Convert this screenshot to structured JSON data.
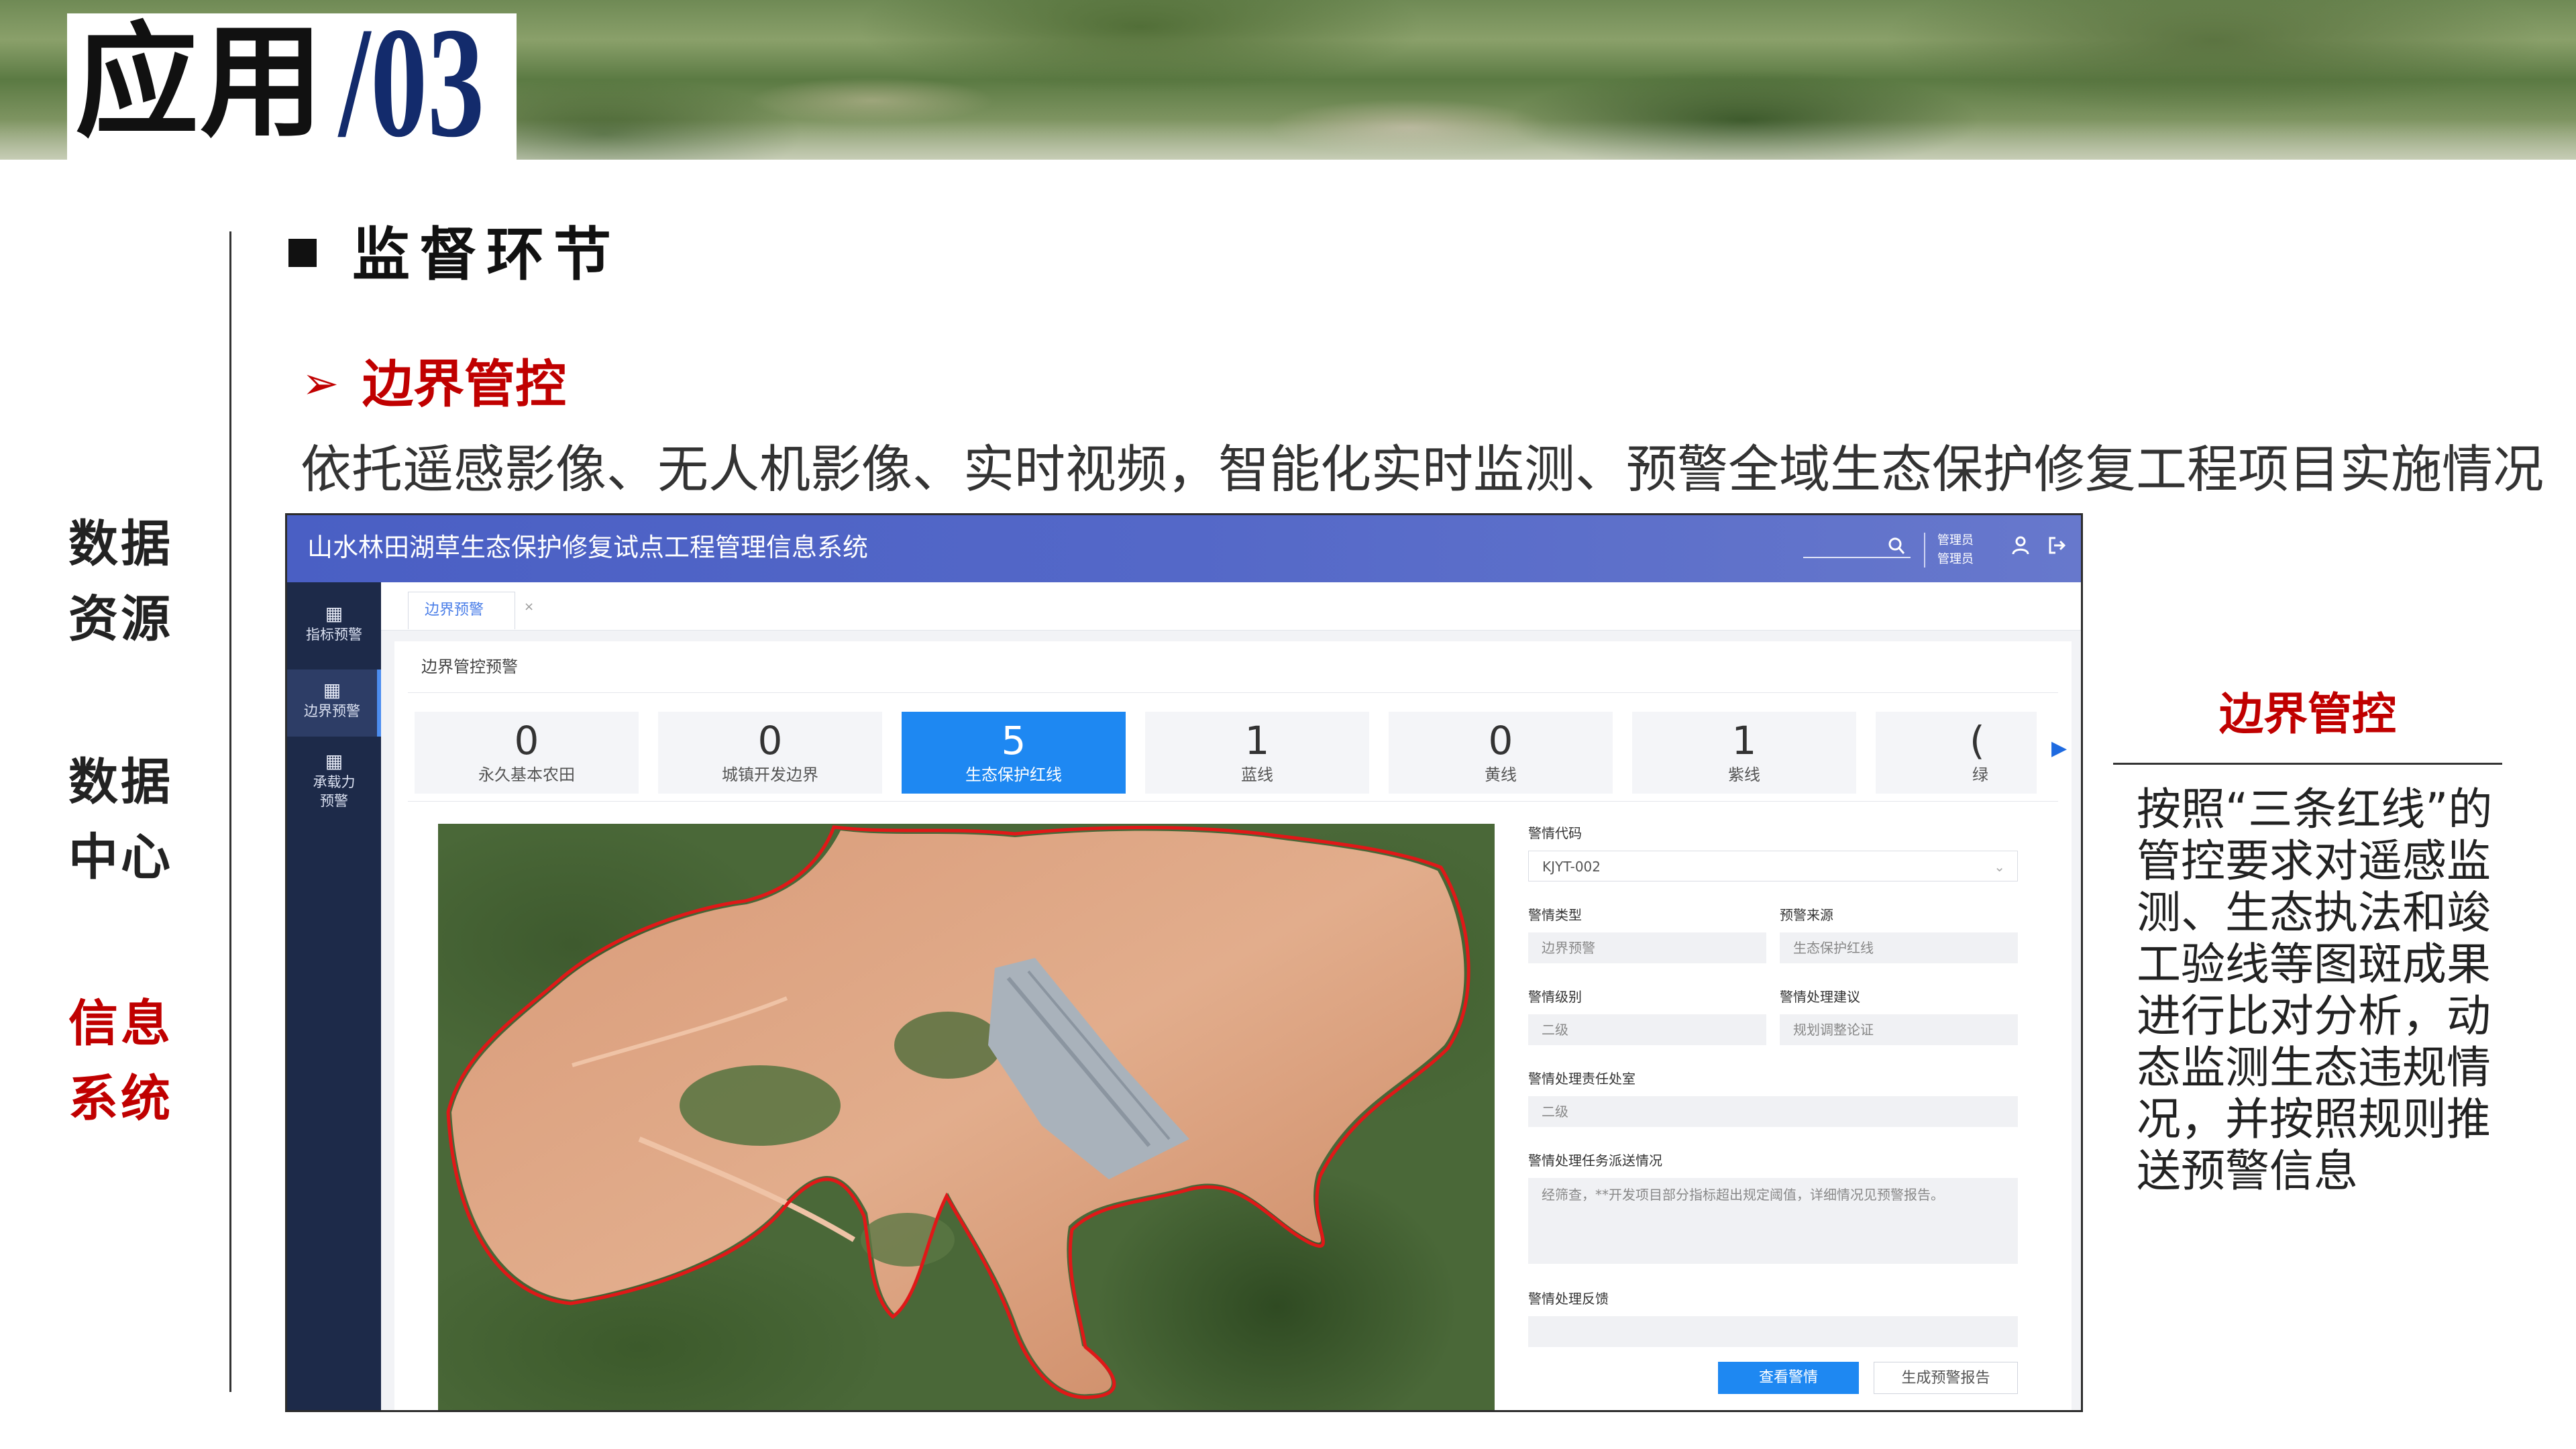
{
  "slide": {
    "title_cn": "应用",
    "title_num": "/03",
    "left_nav": [
      {
        "line1": "数据",
        "line2": "资源"
      },
      {
        "line1": "数据",
        "line2": "中心"
      },
      {
        "line1": "信息",
        "line2": "系统"
      }
    ],
    "section_title": "监督环节",
    "bullet_square": "■",
    "bullet_arrow": "➢",
    "sub_title": "边界管控",
    "description": "依托遥感影像、无人机影像、实时视频，智能化实时监测、预警全域生态保护修复工程项目实施情况",
    "right_title": "边界管控",
    "right_text": "按照“三条红线”的管控要求对遥感监测、生态执法和竣工验线等图斑成果进行比对分析，动态监测生态违规情况，并按照规则推送预警信息"
  },
  "app": {
    "title": "山水林田湖草生态保护修复试点工程管理信息系统",
    "header_user_1": "管理员",
    "header_user_2": "管理员",
    "search_icon": "🔍",
    "user_icon": "👤",
    "exit_icon": "⇥",
    "sidebar": [
      {
        "icon": "▦",
        "label": "指标预警"
      },
      {
        "icon": "▦",
        "label": "边界预警"
      },
      {
        "icon": "▦",
        "label": "承载力",
        "label2": "预警"
      }
    ],
    "tab": {
      "label": "边界预警",
      "close": "×"
    },
    "panel_title": "边界管控预警",
    "stats": [
      {
        "value": "0",
        "label": "永久基本农田"
      },
      {
        "value": "0",
        "label": "城镇开发边界"
      },
      {
        "value": "5",
        "label": "生态保护红线"
      },
      {
        "value": "1",
        "label": "蓝线"
      },
      {
        "value": "0",
        "label": "黄线"
      },
      {
        "value": "1",
        "label": "紫线"
      },
      {
        "value": "(",
        "label": "绿"
      }
    ],
    "stats_arrow": "▶",
    "form": {
      "code_label": "警情代码",
      "code_value": "KJYT-002",
      "chev": "⌄",
      "type_label": "警情类型",
      "type_value": "边界预警",
      "source_label": "预警来源",
      "source_value": "生态保护红线",
      "level_label": "警情级别",
      "level_value": "二级",
      "advice_label": "警情处理建议",
      "advice_value": "规划调整论证",
      "dept_label": "警情处理责任处室",
      "dept_value": "二级",
      "task_label": "警情处理任务派送情况",
      "task_value": "经筛查，**开发项目部分指标超出规定阈值，详细情况见预警报告。",
      "feedback_label": "警情处理反馈",
      "feedback_value": "",
      "btn_view": "查看警情",
      "btn_report": "生成预警报告"
    }
  },
  "colors": {
    "accent_red": "#c00000",
    "app_header_blue": "#4a5fc4",
    "primary_blue": "#1e88f2",
    "sidebar_navy": "#1d2a49",
    "boundary_red": "#e01818"
  }
}
